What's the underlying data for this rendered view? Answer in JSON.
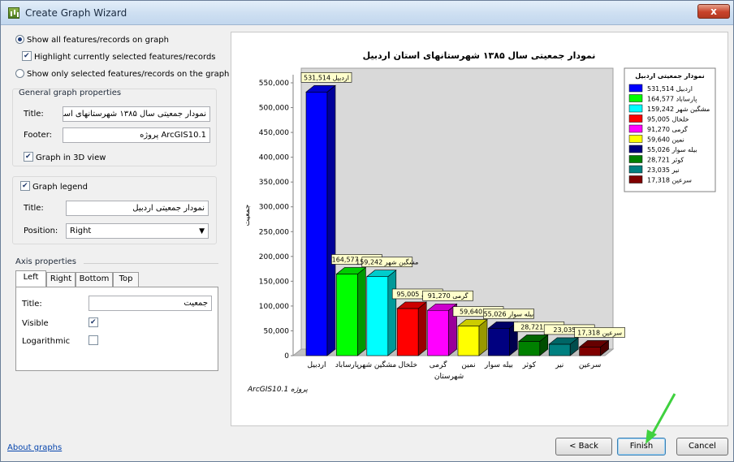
{
  "window": {
    "title": "Create Graph Wizard",
    "close_glyph": "x"
  },
  "options": {
    "show_all": "Show all features/records on graph",
    "highlight": "Highlight currently selected features/records",
    "show_selected": "Show only selected features/records on the graph"
  },
  "general": {
    "caption": "General graph properties",
    "title_label": "Title:",
    "title_value": "نمودار جمعیتی سال ۱۳۸۵ شهرستانهای استان اردبیل",
    "footer_label": "Footer:",
    "footer_value": "ArcGIS10.1 پروژه",
    "graph3d_label": "Graph in 3D view"
  },
  "legend": {
    "caption": "Graph legend",
    "title_label": "Title:",
    "title_value": "نمودار جمعیتی اردبیل",
    "position_label": "Position:",
    "position_value": "Right"
  },
  "axis": {
    "caption": "Axis properties",
    "tabs": [
      "Left",
      "Right",
      "Bottom",
      "Top"
    ],
    "title_label": "Title:",
    "title_value": "جمعیت",
    "visible_label": "Visible",
    "log_label": "Logarithmic"
  },
  "footer": {
    "about": "About graphs",
    "back": "< Back",
    "finish": "Finish",
    "cancel": "Cancel"
  },
  "colors": {
    "plot_bg": "#d9d9d9",
    "accent_arrow": "#3fd13f"
  },
  "chart_data": {
    "type": "bar",
    "title": "نمودار جمعیتی سال ۱۳۸۵ شهرستانهای استان اردبیل",
    "ylabel": "جمعیت",
    "xlabel": "شهرستان",
    "footer": "ArcGIS10.1 پروژه",
    "ylim": [
      0,
      550000
    ],
    "yticks": [
      "0",
      "50,000",
      "100,000",
      "150,000",
      "200,000",
      "250,000",
      "300,000",
      "350,000",
      "400,000",
      "450,000",
      "500,000",
      "550,000"
    ],
    "categories": [
      "اردبیل",
      "پارساباد",
      "مشگین شهر",
      "خلخال",
      "گرمی",
      "نمین",
      "بیله سوار",
      "کوثر",
      "نیر",
      "سرعین"
    ],
    "values": [
      531514,
      164577,
      159242,
      95005,
      91270,
      59640,
      55026,
      28721,
      23035,
      17318
    ],
    "value_labels": [
      "531,514",
      "164,577",
      "159,242",
      "95,005",
      "91,270",
      "59,640",
      "55,026",
      "28,721",
      "23,035",
      "17,318"
    ],
    "colors": [
      "#0000ff",
      "#00ff00",
      "#00ffff",
      "#ff0000",
      "#ff00ff",
      "#ffff00",
      "#000080",
      "#008000",
      "#008080",
      "#800000"
    ],
    "legend": {
      "title": "نمودار جمعیتی اردبیل",
      "position": "right"
    },
    "grid": false
  }
}
